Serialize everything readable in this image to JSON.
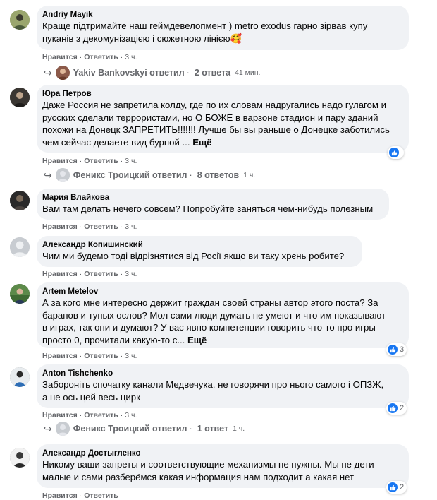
{
  "actions": {
    "like": "Нравится",
    "reply": "Ответить",
    "dot": "·"
  },
  "comments": [
    {
      "author": "Andriy Mayik",
      "lines": [
        "Краще підтримайте наш геймдевелопмент ) metro exodus гарно зірвав купу",
        "пуканів з декомунізацією і сюжетною лінією🥰"
      ],
      "time": "3 ч."
    },
    {
      "author": "Юра Петров",
      "lines": [
        "Даже Россия не запретила колду, где по их словам надругались надо гулагом и",
        "русских сделали террористами, но О БОЖЕ в варзоне стадион и пару зданий",
        "похожи на Донецк ЗАПРЕТИТЬ!!!!!!! Лучше бы вы раньше о Донецке заботились",
        "чем сейчас делаете вид бурной ..."
      ],
      "more": "Ещё",
      "time": "3 ч.",
      "reactions": ""
    },
    {
      "author": "Мария Влайкова",
      "lines": [
        "Вам там делать нечего совсем? Попробуйте заняться чем-нибудь полезным"
      ],
      "time": "3 ч."
    },
    {
      "author": "Александр Копишинский",
      "lines": [
        "Чим ми будемо тоді відрізнятися від Росії якщо ви таку хрєнь робите?"
      ],
      "time": "3 ч."
    },
    {
      "author": "Artem Metelov",
      "lines": [
        "А за кого мне интересно держит граждан своей страны автор этого поста? За",
        "баранов и тупых ослов? Мол сами люди думать не умеют и что им показывают",
        "в играх, так они и думают? У вас явно компетенции говорить что-то про игры",
        "просто 0, прочитали какую-то с..."
      ],
      "more": "Ещё",
      "time": "3 ч.",
      "reactions": "3"
    },
    {
      "author": "Anton Tishchenko",
      "lines": [
        "Забороніть спочатку канали Медвечука, не говорячи про нього самого і ОПЗЖ,",
        "а не ось цей весь цирк"
      ],
      "time": "3 ч.",
      "reactions": "2"
    },
    {
      "author": "Александр Достыгленко",
      "lines": [
        "Никому ваши запреты и соответствующие механизмы не нужны. Мы не дети",
        "малые и сами разберёмся какая информация нам подходит а какая нет"
      ],
      "time": "",
      "reactions": "2"
    }
  ],
  "replies": [
    {
      "who": "Yakiv Bankovskyi ответил",
      "count": "2 ответа",
      "time": "41 мин."
    },
    {
      "who": "Феникс Троицкий ответил",
      "count": "8 ответов",
      "time": "1 ч."
    },
    {
      "who": "Феникс Троицкий ответил",
      "count": "1 ответ",
      "time": "1 ч."
    }
  ],
  "colors": {
    "like": "#1877f2",
    "bubble": "#f0f2f5",
    "meta": "#65676b"
  }
}
